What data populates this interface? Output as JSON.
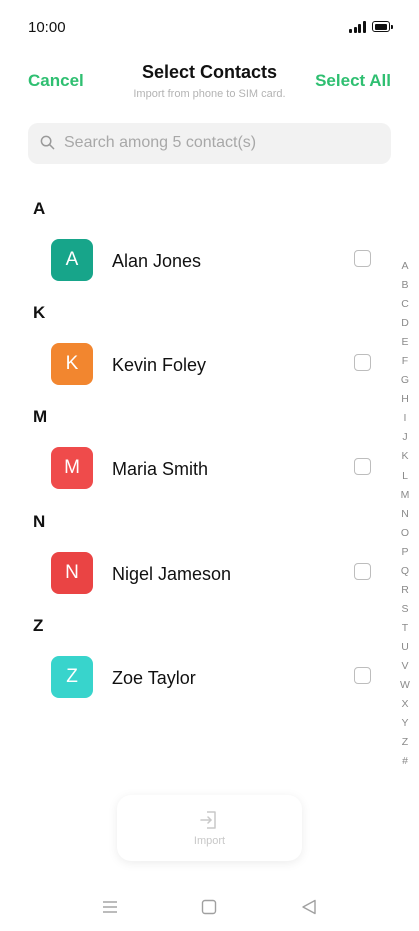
{
  "status_bar": {
    "time": "10:00",
    "signal_icon": "signal-icon",
    "battery_icon": "battery-icon"
  },
  "header": {
    "cancel_label": "Cancel",
    "title": "Select Contacts",
    "subtitle": "Import from phone to SIM card.",
    "select_all_label": "Select All",
    "accent_color": "#2fbf71"
  },
  "search": {
    "placeholder": "Search among 5 contact(s)",
    "icon": "search-icon"
  },
  "sections": [
    {
      "letter": "A",
      "contacts": [
        {
          "initial": "A",
          "name": "Alan Jones",
          "color": "#17a58a",
          "checked": false
        }
      ]
    },
    {
      "letter": "K",
      "contacts": [
        {
          "initial": "K",
          "name": "Kevin Foley",
          "color": "#f2862f",
          "checked": false
        }
      ]
    },
    {
      "letter": "M",
      "contacts": [
        {
          "initial": "M",
          "name": "Maria Smith",
          "color": "#ef4b4b",
          "checked": false
        }
      ]
    },
    {
      "letter": "N",
      "contacts": [
        {
          "initial": "N",
          "name": "Nigel Jameson",
          "color": "#ea4444",
          "checked": false
        }
      ]
    },
    {
      "letter": "Z",
      "contacts": [
        {
          "initial": "Z",
          "name": "Zoe Taylor",
          "color": "#38d4cc",
          "checked": false
        }
      ]
    }
  ],
  "alphabet_index": [
    "A",
    "B",
    "C",
    "D",
    "E",
    "F",
    "G",
    "H",
    "I",
    "J",
    "K",
    "L",
    "M",
    "N",
    "O",
    "P",
    "Q",
    "R",
    "S",
    "T",
    "U",
    "V",
    "W",
    "X",
    "Y",
    "Z",
    "#"
  ],
  "import_button": {
    "label": "Import",
    "icon": "import-icon",
    "enabled": false
  },
  "nav_bar": {
    "icons": [
      "menu-icon",
      "home-icon",
      "back-icon"
    ]
  }
}
